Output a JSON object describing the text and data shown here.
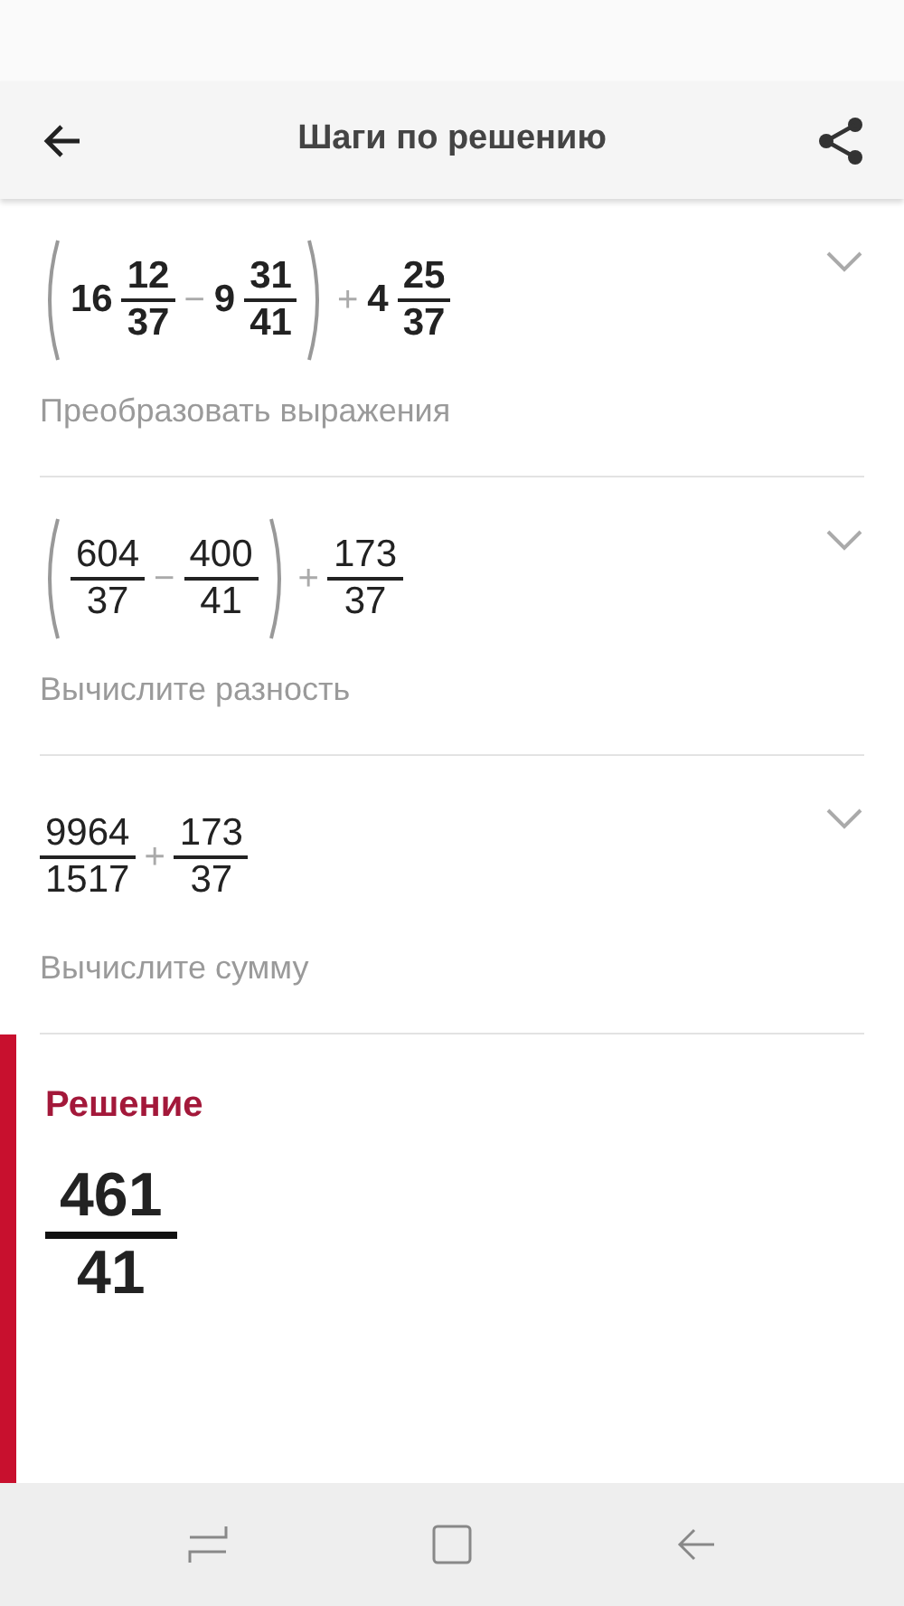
{
  "header": {
    "title": "Шаги по решению"
  },
  "steps": [
    {
      "expression": [
        {
          "kind": "open"
        },
        {
          "kind": "mixed",
          "whole": "16",
          "num": "12",
          "den": "37"
        },
        {
          "kind": "op",
          "text": "−"
        },
        {
          "kind": "mixed",
          "whole": "9",
          "num": "31",
          "den": "41"
        },
        {
          "kind": "close"
        },
        {
          "kind": "op",
          "text": "+"
        },
        {
          "kind": "mixed",
          "whole": "4",
          "num": "25",
          "den": "37"
        }
      ],
      "caption": "Преобразовать выражения",
      "bold": true
    },
    {
      "expression": [
        {
          "kind": "open"
        },
        {
          "kind": "fraction",
          "num": "604",
          "den": "37"
        },
        {
          "kind": "op",
          "text": "−"
        },
        {
          "kind": "fraction",
          "num": "400",
          "den": "41"
        },
        {
          "kind": "close"
        },
        {
          "kind": "op",
          "text": "+"
        },
        {
          "kind": "fraction",
          "num": "173",
          "den": "37"
        }
      ],
      "caption": "Вычислите разность",
      "bold": false
    },
    {
      "expression": [
        {
          "kind": "fraction",
          "num": "9964",
          "den": "1517"
        },
        {
          "kind": "op",
          "text": "+"
        },
        {
          "kind": "fraction",
          "num": "173",
          "den": "37"
        }
      ],
      "caption": "Вычислите сумму",
      "bold": false
    }
  ],
  "solution": {
    "title": "Решение",
    "num": "461",
    "den": "41"
  }
}
